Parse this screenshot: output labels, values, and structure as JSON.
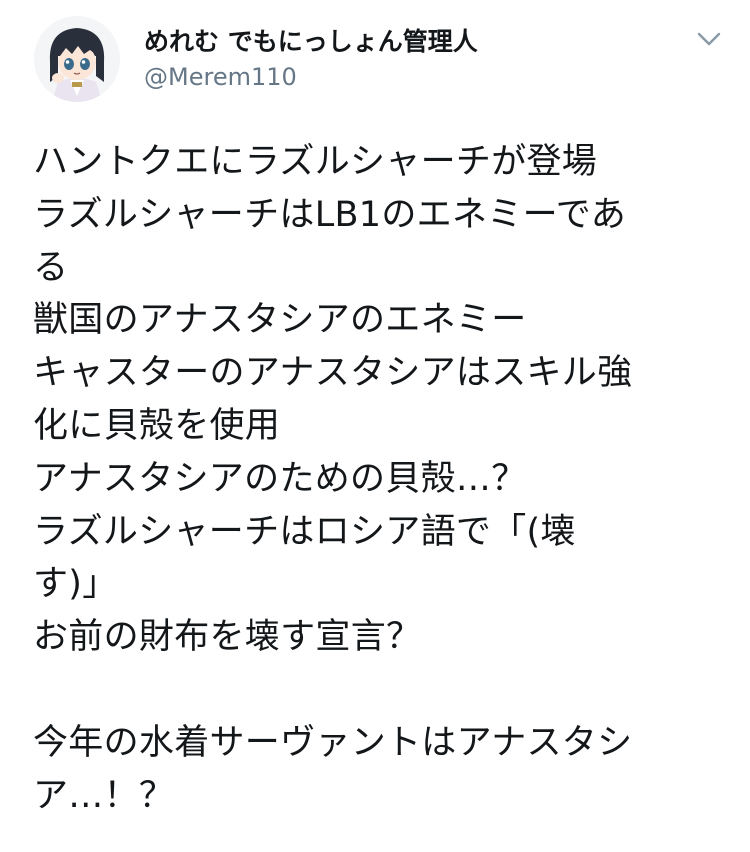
{
  "header": {
    "display_name": "めれむ でもにっしょん管理人",
    "handle": "@Merem110",
    "avatar_icon": "avatar-icon",
    "menu_icon": "chevron-down-icon"
  },
  "tweet": {
    "lines": [
      "ハントクエにラズルシャーチが登場",
      "ラズルシャーチはLB1のエネミーであ",
      "る",
      "獣国のアナスタシアのエネミー",
      "キャスターのアナスタシアはスキル強",
      "化に貝殻を使用",
      "アナスタシアのための貝殻…？",
      "ラズルシャーチはロシア語で「(壊",
      "す)」",
      "お前の財布を壊す宣言？",
      "",
      "今年の水着サーヴァントはアナスタシ",
      "ア…！？"
    ]
  },
  "colors": {
    "text": "#14171a",
    "secondary": "#657786",
    "chevron": "#8899a6"
  }
}
